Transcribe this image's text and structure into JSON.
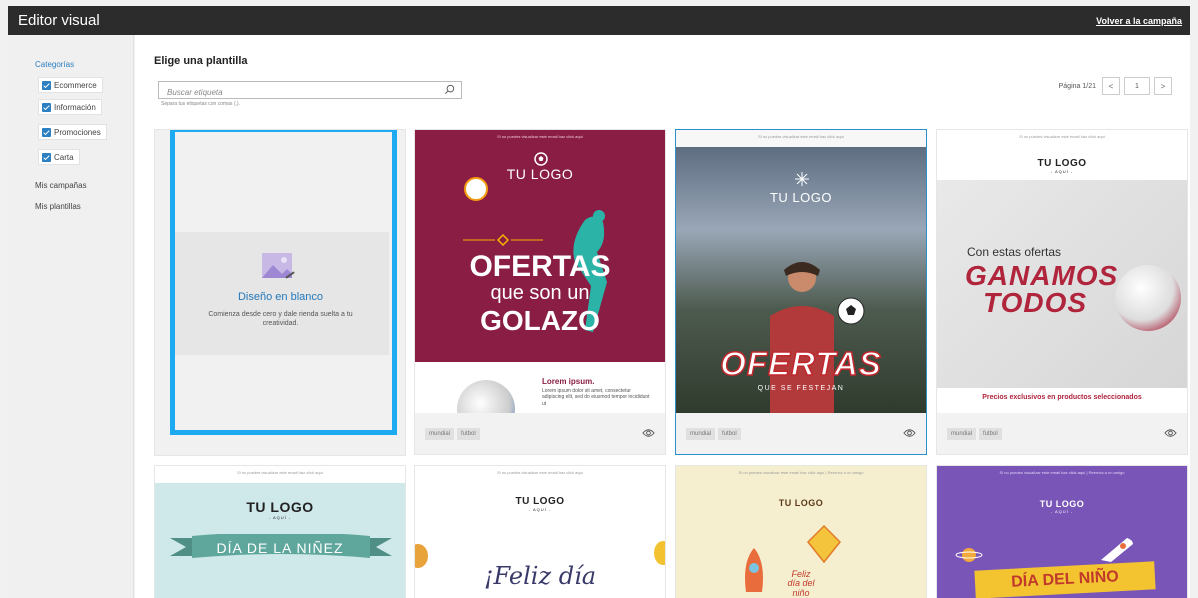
{
  "topbar": {
    "title": "Editor visual",
    "back_label": "Volver a la campaña"
  },
  "sidebar": {
    "categories_title": "Categorías",
    "categories": [
      {
        "label": "Ecommerce",
        "checked": true
      },
      {
        "label": "Información",
        "checked": true
      },
      {
        "label": "Promociones",
        "checked": true
      },
      {
        "label": "Carta",
        "checked": true
      }
    ],
    "links": [
      "Mis campañas",
      "Mis plantillas"
    ]
  },
  "main": {
    "heading": "Elige una plantilla",
    "search": {
      "placeholder": "Buscar etiqueta",
      "hint": "Separa tus etiquetas con comas (,)."
    },
    "pager": {
      "label": "Página 1/21",
      "prev": "<",
      "current": "1",
      "next": ">"
    }
  },
  "blank_card": {
    "title": "Diseño en blanco",
    "description": "Comienza desde cero y dale rienda suelta a tu creatividad."
  },
  "templates": [
    {
      "pretext": "Si no puedes visualizar este email haz click aquí",
      "logo": "TU LOGO",
      "headline": [
        "OFERTAS",
        "que son un",
        "GOLAZO"
      ],
      "lower_title": "Lorem ipsum.",
      "lower_text": "Lorem ipsum dolor sit amet, consectetur adipiscing elit, sed do eiusmod tempor incididunt ut",
      "tags": [
        "mundial",
        "futbol"
      ]
    },
    {
      "pretext": "Si no puedes visualizar este email haz click aquí",
      "logo": "TU LOGO",
      "headline": "OFERTAS",
      "subline": "QUE SE FESTEJAN",
      "tags": [
        "mundial",
        "futbol"
      ]
    },
    {
      "pretext": "Si no puedes visualizar este email haz click aquí",
      "logo": "TU LOGO",
      "logo_sub": "- AQUÍ -",
      "line1": "Con estas ofertas",
      "line2": [
        "GANAMOS",
        "TODOS"
      ],
      "line3": "Precios exclusivos en productos seleccionados",
      "tags": [
        "mundial",
        "futbol"
      ]
    },
    {
      "pretext": "Si no puedes visualizar este email haz click aquí",
      "logo": "TU LOGO",
      "logo_sub": "- AQUÍ -",
      "headline": "DÍA DE LA NIÑEZ"
    },
    {
      "pretext": "Si no puedes visualizar este email haz click aquí",
      "logo": "TU LOGO",
      "logo_sub": "- AQUÍ -",
      "headline": "¡Feliz día"
    },
    {
      "pretext": "Si no puedes visualizar este email haz click aquí | Reenvía a un amigo",
      "logo": "TU LOGO",
      "headline": [
        "Feliz",
        "día del",
        "niño"
      ]
    },
    {
      "pretext": "Si no puedes visualizar este email haz click aquí | Reenvía a un amigo",
      "logo": "TU LOGO",
      "logo_sub": "- AQUÍ -",
      "headline": "DÍA DEL NIÑO"
    }
  ],
  "colors": {
    "topbar": "#2c2c2c",
    "accent": "#2c7fc0",
    "selection": "#1daaf0",
    "maroon": "#8a1d43",
    "red": "#b0243c",
    "purple": "#7a55b8"
  }
}
